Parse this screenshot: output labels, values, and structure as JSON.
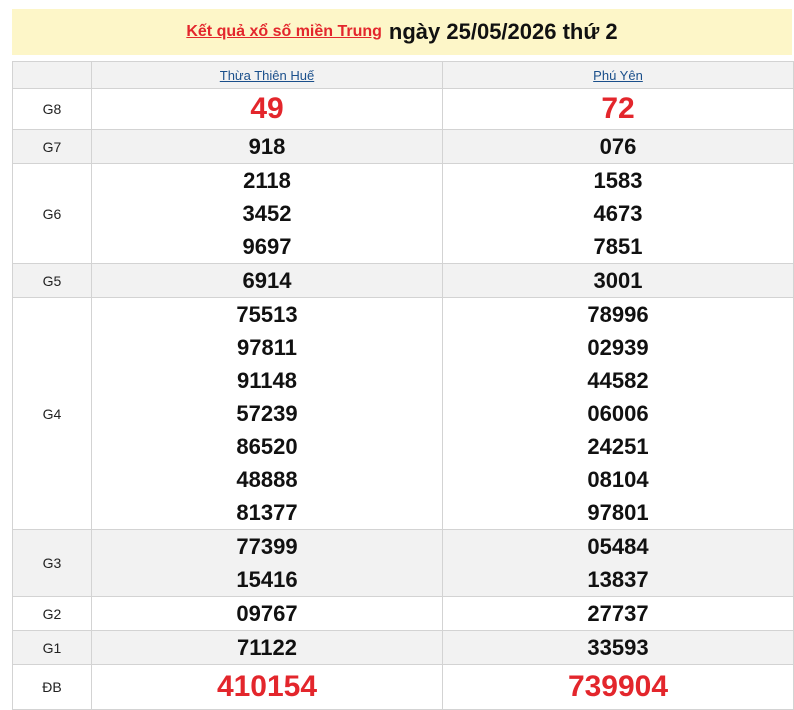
{
  "header": {
    "link_text": "Kết quả xổ số miền Trung",
    "date_text": "ngày 25/05/2026 thứ 2"
  },
  "provinces": [
    "Thừa Thiên Huế",
    "Phú Yên"
  ],
  "prizes": [
    {
      "label": "G8",
      "p1": [
        "49"
      ],
      "p2": [
        "72"
      ]
    },
    {
      "label": "G7",
      "p1": [
        "918"
      ],
      "p2": [
        "076"
      ]
    },
    {
      "label": "G6",
      "p1": [
        "2118",
        "3452",
        "9697"
      ],
      "p2": [
        "1583",
        "4673",
        "7851"
      ]
    },
    {
      "label": "G5",
      "p1": [
        "6914"
      ],
      "p2": [
        "3001"
      ]
    },
    {
      "label": "G4",
      "p1": [
        "75513",
        "97811",
        "91148",
        "57239",
        "86520",
        "48888",
        "81377"
      ],
      "p2": [
        "78996",
        "02939",
        "44582",
        "06006",
        "24251",
        "08104",
        "97801"
      ]
    },
    {
      "label": "G3",
      "p1": [
        "77399",
        "15416"
      ],
      "p2": [
        "05484",
        "13837"
      ]
    },
    {
      "label": "G2",
      "p1": [
        "09767"
      ],
      "p2": [
        "27737"
      ]
    },
    {
      "label": "G1",
      "p1": [
        "71122"
      ],
      "p2": [
        "33593"
      ]
    },
    {
      "label": "ĐB",
      "p1": [
        "410154"
      ],
      "p2": [
        "739904"
      ]
    }
  ],
  "colors": {
    "accent_red": "#e3262c",
    "link_blue": "#1a4f8b",
    "header_bg": "#fdf6c8",
    "row_shade": "#f2f2f2"
  }
}
